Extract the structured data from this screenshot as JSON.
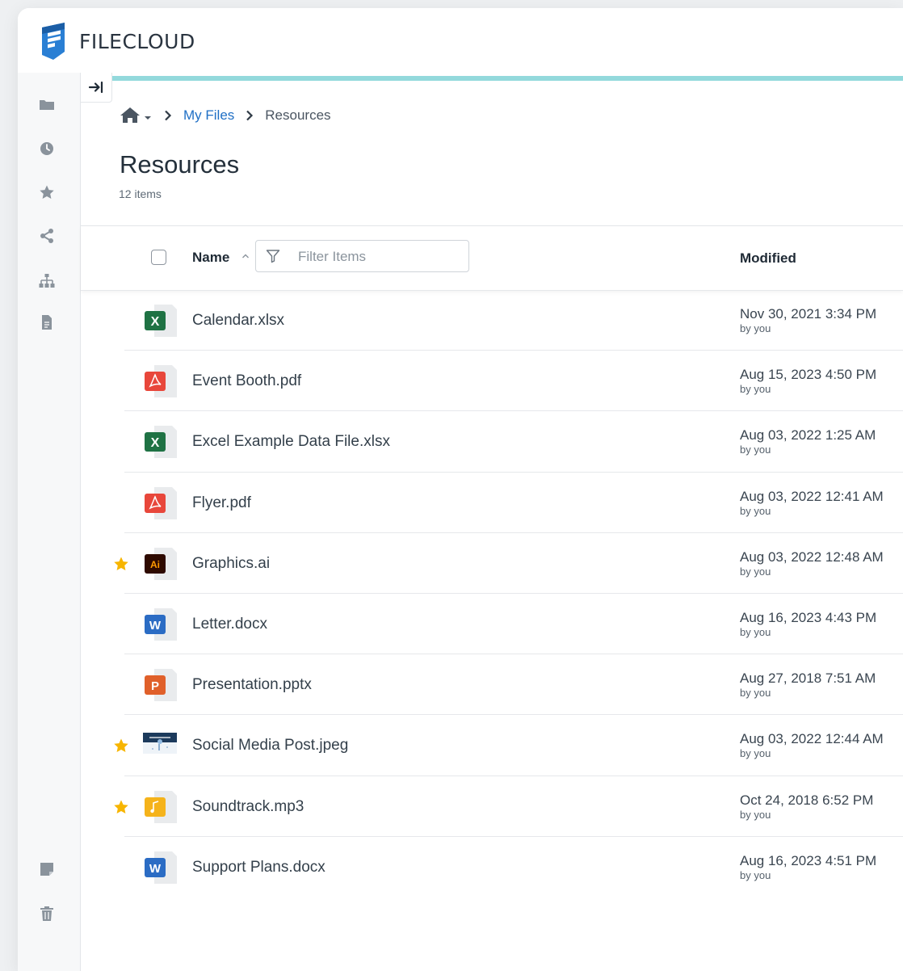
{
  "app": {
    "brand": "FILECLOUD",
    "colors": {
      "accent": "#93d9dc",
      "link": "#1f6fc5",
      "brand_blue": "#2a7fd4",
      "star": "#f7b500",
      "excel": "#1f7244",
      "pdf": "#e8473b",
      "illustrator": "#2e0a00",
      "word": "#2b6cc4",
      "powerpoint": "#e0602a",
      "audio": "#f5b31b"
    }
  },
  "sidebar": {
    "items": [
      {
        "name": "folder-icon"
      },
      {
        "name": "clock-icon"
      },
      {
        "name": "star-icon"
      },
      {
        "name": "share-icon"
      },
      {
        "name": "sitemap-icon"
      },
      {
        "name": "document-icon"
      },
      {
        "name": "note-icon"
      },
      {
        "name": "trash-icon"
      }
    ]
  },
  "breadcrumb": {
    "home_icon": "home-icon",
    "items": [
      "My Files",
      "Resources"
    ]
  },
  "page": {
    "title": "Resources",
    "count": "12 items"
  },
  "list_header": {
    "name": "Name",
    "filter_placeholder": "Filter Items",
    "modified": "Modified"
  },
  "files": [
    {
      "name": "Calendar.xlsx",
      "type": "excel",
      "starred": false,
      "date": "Nov 30, 2021 3:34 PM",
      "by": "by you"
    },
    {
      "name": "Event Booth.pdf",
      "type": "pdf",
      "starred": false,
      "date": "Aug 15, 2023 4:50 PM",
      "by": "by you"
    },
    {
      "name": "Excel Example Data File.xlsx",
      "type": "excel",
      "starred": false,
      "date": "Aug 03, 2022 1:25 AM",
      "by": "by you"
    },
    {
      "name": "Flyer.pdf",
      "type": "pdf",
      "starred": false,
      "date": "Aug 03, 2022 12:41 AM",
      "by": "by you"
    },
    {
      "name": "Graphics.ai",
      "type": "illustrator",
      "starred": true,
      "date": "Aug 03, 2022 12:48 AM",
      "by": "by you"
    },
    {
      "name": "Letter.docx",
      "type": "word",
      "starred": false,
      "date": "Aug 16, 2023 4:43 PM",
      "by": "by you"
    },
    {
      "name": "Presentation.pptx",
      "type": "powerpoint",
      "starred": false,
      "date": "Aug 27, 2018 7:51 AM",
      "by": "by you"
    },
    {
      "name": "Social Media Post.jpeg",
      "type": "image",
      "starred": true,
      "date": "Aug 03, 2022 12:44 AM",
      "by": "by you"
    },
    {
      "name": "Soundtrack.mp3",
      "type": "audio",
      "starred": true,
      "date": "Oct 24, 2018 6:52 PM",
      "by": "by you"
    },
    {
      "name": "Support Plans.docx",
      "type": "word",
      "starred": false,
      "date": "Aug 16, 2023 4:51 PM",
      "by": "by you"
    }
  ]
}
